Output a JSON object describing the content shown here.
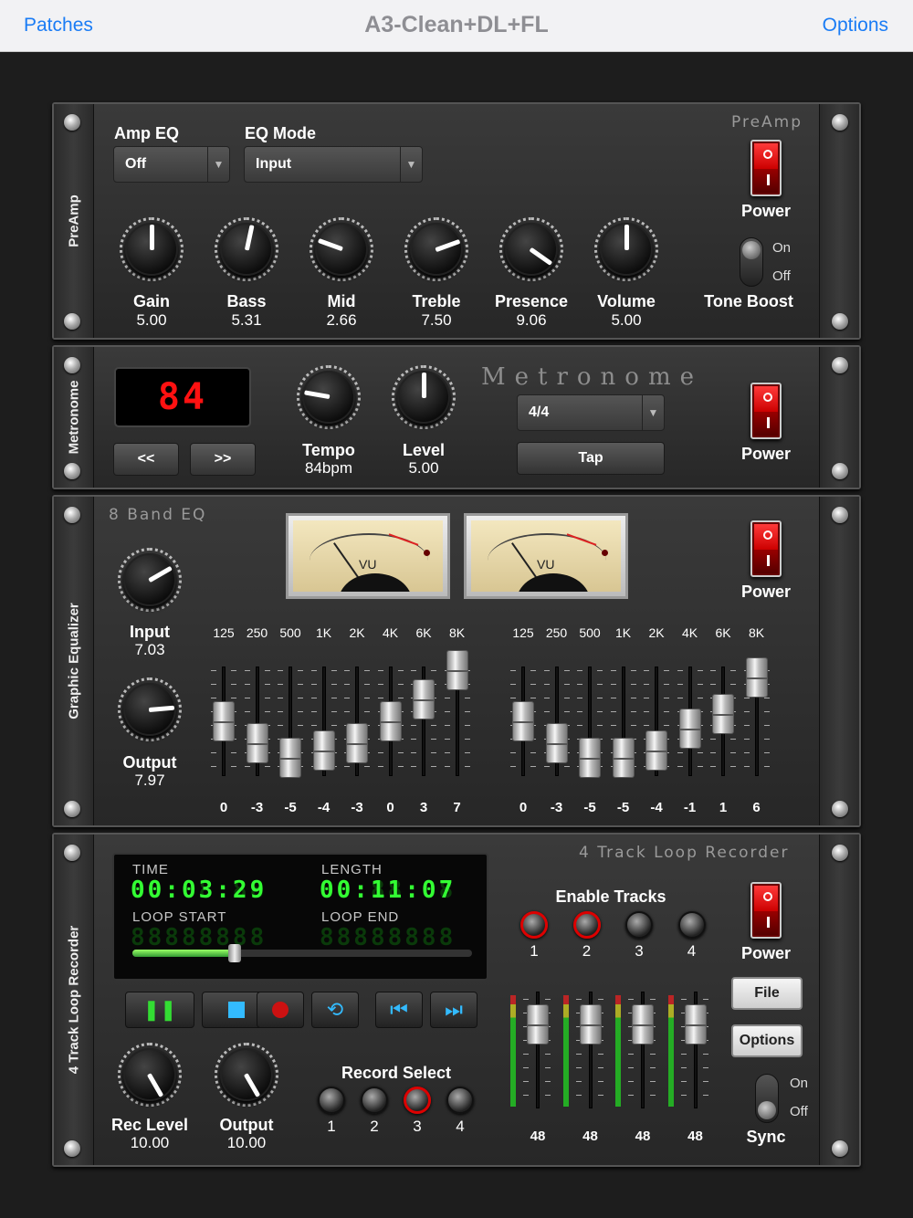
{
  "nav": {
    "left": "Patches",
    "title": "A3-Clean+DL+FL",
    "right": "Options"
  },
  "preamp": {
    "side": "PreAmp",
    "brand": "PreAmp",
    "amp_eq_label": "Amp EQ",
    "amp_eq_value": "Off",
    "eq_mode_label": "EQ Mode",
    "eq_mode_value": "Input",
    "power": "Power",
    "tone_on": "On",
    "tone_off": "Off",
    "tone": "Tone Boost",
    "knobs": [
      {
        "label": "Gain",
        "value": "5.00"
      },
      {
        "label": "Bass",
        "value": "5.31"
      },
      {
        "label": "Mid",
        "value": "2.66"
      },
      {
        "label": "Treble",
        "value": "7.50"
      },
      {
        "label": "Presence",
        "value": "9.06"
      },
      {
        "label": "Volume",
        "value": "5.00"
      }
    ]
  },
  "metronome": {
    "side": "Metronome",
    "brand": "Metronome",
    "display": "84",
    "prev": "<<",
    "next": ">>",
    "tempo_label": "Tempo",
    "tempo_value": "84bpm",
    "level_label": "Level",
    "level_value": "5.00",
    "time_sig": "4/4",
    "tap": "Tap",
    "power": "Power"
  },
  "eq": {
    "side": "Graphic Equalizer",
    "brand": "8 Band EQ",
    "vu_label": "VU",
    "input_label": "Input",
    "input_value": "7.03",
    "output_label": "Output",
    "output_value": "7.97",
    "power": "Power",
    "freqs": [
      "125",
      "250",
      "500",
      "1K",
      "2K",
      "4K",
      "6K",
      "8K"
    ],
    "left_gains": [
      "0",
      "-3",
      "-5",
      "-4",
      "-3",
      "0",
      "3",
      "7"
    ],
    "right_gains": [
      "0",
      "-3",
      "-5",
      "-5",
      "-4",
      "-1",
      "1",
      "6"
    ]
  },
  "looper": {
    "side": "4 Track Loop Recorder",
    "brand": "4 Track Loop Recorder",
    "time_label": "TIME",
    "time_value": "00:03:29",
    "length_label": "LENGTH",
    "length_value": "00:11:07",
    "loop_start": "LOOP START",
    "loop_end": "LOOP END",
    "progress": 0.3,
    "enable_tracks": "Enable Tracks",
    "tracks": [
      "1",
      "2",
      "3",
      "4"
    ],
    "record_select": "Record Select",
    "rec_level_label": "Rec Level",
    "rec_level_value": "10.00",
    "output_label": "Output",
    "output_value": "10.00",
    "fader_values": [
      "48",
      "48",
      "48",
      "48"
    ],
    "power": "Power",
    "file": "File",
    "options": "Options",
    "sync_on": "On",
    "sync_off": "Off",
    "sync": "Sync"
  }
}
